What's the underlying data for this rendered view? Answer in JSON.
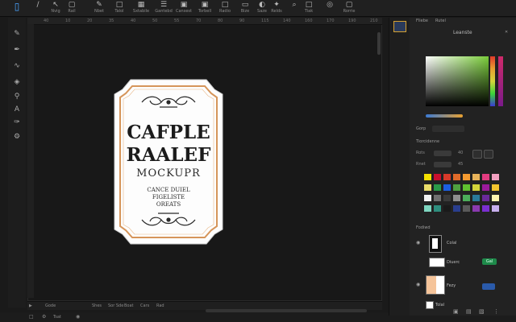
{
  "toolbar": {
    "tools": [
      {
        "icon": "∕",
        "label": ""
      },
      {
        "icon": "↖",
        "label": "Nvig"
      },
      {
        "icon": "▢",
        "label": "Rail"
      },
      {
        "icon": "✎",
        "label": "Nbet"
      },
      {
        "icon": "□",
        "label": "Talol"
      },
      {
        "icon": "▦",
        "label": "Sxtabile"
      },
      {
        "icon": "☰",
        "label": "Gantebd"
      },
      {
        "icon": "▣",
        "label": "Cansest"
      },
      {
        "icon": "▣",
        "label": "Torbell"
      },
      {
        "icon": "□",
        "label": "Radio"
      },
      {
        "icon": "▭",
        "label": "Bize"
      },
      {
        "icon": "◐",
        "label": "Saze"
      },
      {
        "icon": "✦",
        "label": "Relds"
      },
      {
        "icon": "⌕",
        "label": ""
      },
      {
        "icon": "□",
        "label": "Tiak"
      },
      {
        "icon": "◎",
        "label": ""
      },
      {
        "icon": "▢",
        "label": "Rorrie"
      }
    ]
  },
  "ruler_top": [
    "40",
    "10",
    "20",
    "35",
    "40",
    "50",
    "55",
    "70",
    "80",
    "90",
    "115",
    "140",
    "160",
    "170",
    "190",
    "210"
  ],
  "label_artwork": {
    "line1": "CAFPLE",
    "line2": "RAALEF",
    "line3": "MOCKUPR",
    "line4": "CANCE DUIEL",
    "line5": "FIGELISTE",
    "line6": "OREATS",
    "border_color": "#d6955a"
  },
  "statusbar": {
    "zoom": "Gode",
    "items": [
      "Shes",
      "Sor Sde",
      "Boat",
      "Cars",
      "Rad"
    ]
  },
  "bottombar": {
    "items": [
      "□",
      "⚙",
      "Tsat",
      "◉"
    ]
  },
  "panel": {
    "tabs": [
      "Fliebe",
      "Rutel"
    ],
    "section_title": "Leanste",
    "color_section_label": "Gorp",
    "properties_label": "Tiorcidenne",
    "rows": [
      {
        "label": "Rots",
        "value": "40"
      },
      {
        "label": "Rnet",
        "value": "45"
      }
    ],
    "swatches": [
      [
        "#f5e000",
        "#c8102e",
        "#d83a2a",
        "#e06b2a",
        "#f49a30",
        "#e8b35a",
        "#e23c80",
        "#f2a0c0"
      ],
      [
        "#e9dd6a",
        "#2a9a48",
        "#1c5ee0",
        "#4fa040",
        "#60c030",
        "#d4d43a",
        "#9c1a9c",
        "#f3c52e"
      ],
      [
        "#f2f2f2",
        "#707070",
        "#3a3a3a",
        "#8e8e8e",
        "#4cae5a",
        "#2a7a9a",
        "#6a2a9a",
        "#fff5b0"
      ],
      [
        "#7fd6c0",
        "#2e8e7e",
        "#1a1a1a",
        "#2a3e8e",
        "#5a5a5a",
        "#8a3ab0",
        "#7b2fd0",
        "#c8b0ee"
      ]
    ],
    "layers_title": "Fodiwd",
    "layers": [
      {
        "name": "Colal",
        "mode": ""
      },
      {
        "name": "Diuerc",
        "mode": "Gal"
      },
      {
        "name": "Fezy",
        "mode": ""
      },
      {
        "name": "Tolal",
        "mode": ""
      }
    ],
    "colors": {
      "accent": "#1e8a4a",
      "blue": "#2a5aaa"
    }
  }
}
